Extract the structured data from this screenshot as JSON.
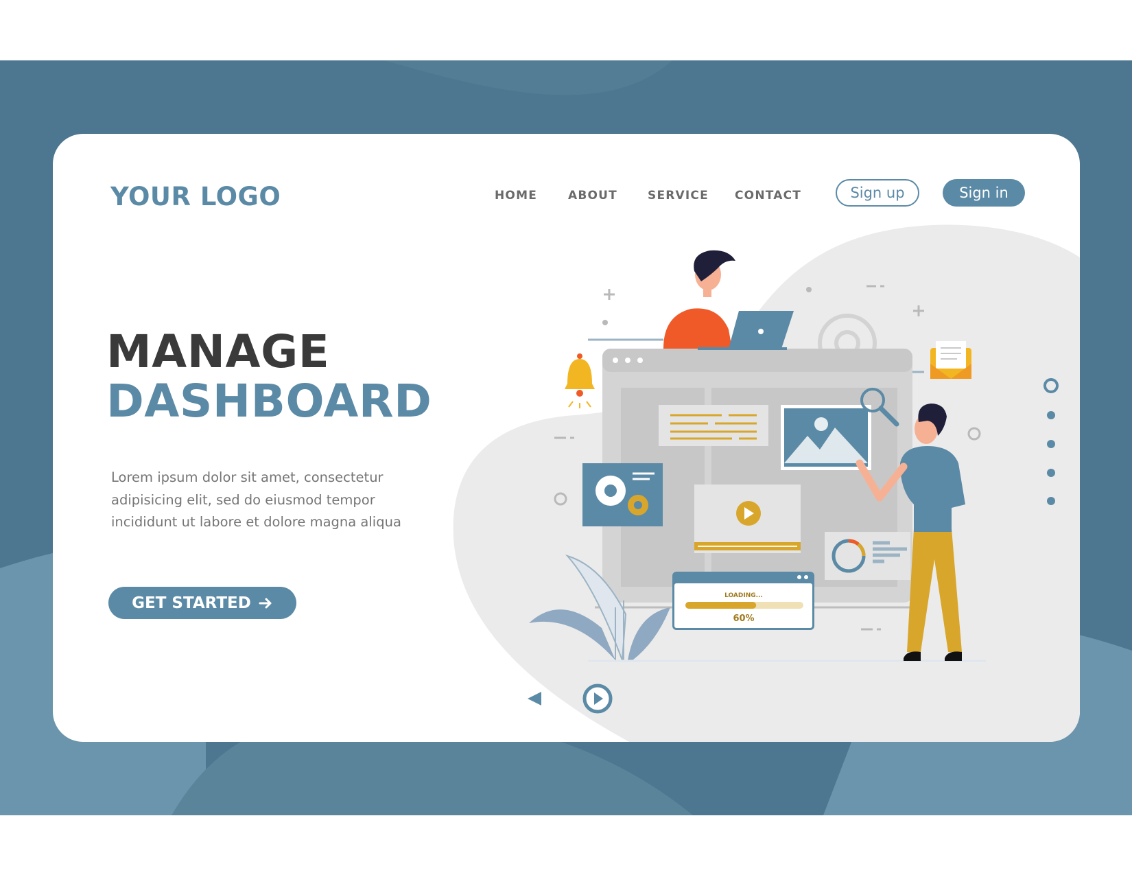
{
  "brand": {
    "logo_text": "YOUR LOGO",
    "accent": "#5b8aa6",
    "background": "#4d7690",
    "highlight": "#d9a62c",
    "orange": "#ef5a28"
  },
  "nav": {
    "items": [
      "HOME",
      "ABOUT",
      "SERVICE",
      "CONTACT"
    ],
    "sign_up": "Sign up",
    "sign_in": "Sign in"
  },
  "hero": {
    "title_line1": "MANAGE",
    "title_line2": "DASHBOARD",
    "description": "Lorem ipsum dolor sit amet, consectetur adipisicing elit, sed do eiusmod tempor incididunt ut labore et dolore magna aliqua",
    "cta_label": "GET STARTED",
    "cta_icon": "arrow-right-icon"
  },
  "illustration": {
    "loading_label": "LOADING...",
    "loading_percent": "60%",
    "progress_fraction": 0.6
  },
  "pagination": {
    "dot_count": 5,
    "active_index": 0
  },
  "controls": {
    "prev_icon": "triangle-left-icon",
    "play_icon": "play-circle-icon"
  }
}
